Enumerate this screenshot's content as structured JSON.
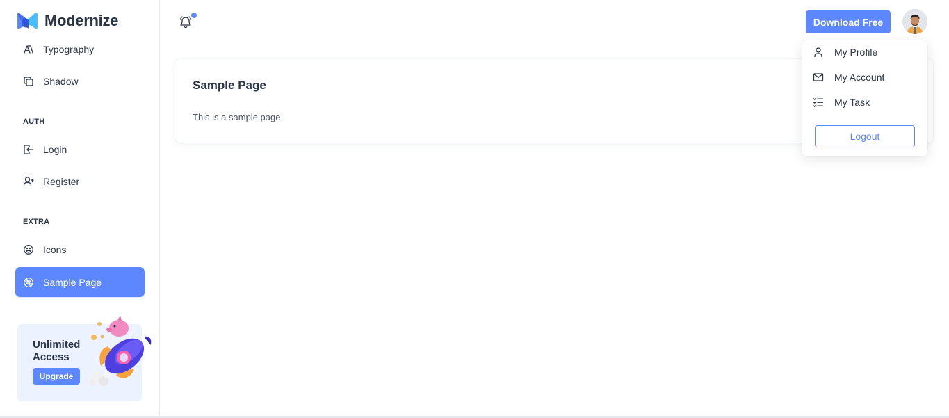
{
  "brand": {
    "name": "Modernize",
    "accent": "#5d87ff"
  },
  "sidebar": {
    "items_top": [
      {
        "label": "Typography",
        "icon": "typography-icon"
      },
      {
        "label": "Shadow",
        "icon": "copy-icon"
      }
    ],
    "auth_caption": "AUTH",
    "auth_items": [
      {
        "label": "Login",
        "icon": "login-icon"
      },
      {
        "label": "Register",
        "icon": "user-plus-icon"
      }
    ],
    "extra_caption": "EXTRA",
    "extra_items": [
      {
        "label": "Icons",
        "icon": "mood-happy-icon"
      },
      {
        "label": "Sample Page",
        "icon": "aperture-icon",
        "active": true
      }
    ],
    "promo": {
      "title": "Unlimited Access",
      "button": "Upgrade"
    }
  },
  "header": {
    "download_label": "Download Free",
    "notification": true
  },
  "profile_menu": {
    "items": [
      {
        "label": "My Profile",
        "icon": "user-icon"
      },
      {
        "label": "My Account",
        "icon": "mail-icon"
      },
      {
        "label": "My Task",
        "icon": "list-check-icon"
      }
    ],
    "logout_label": "Logout"
  },
  "main": {
    "card_title": "Sample Page",
    "card_text": "This is a sample page"
  }
}
